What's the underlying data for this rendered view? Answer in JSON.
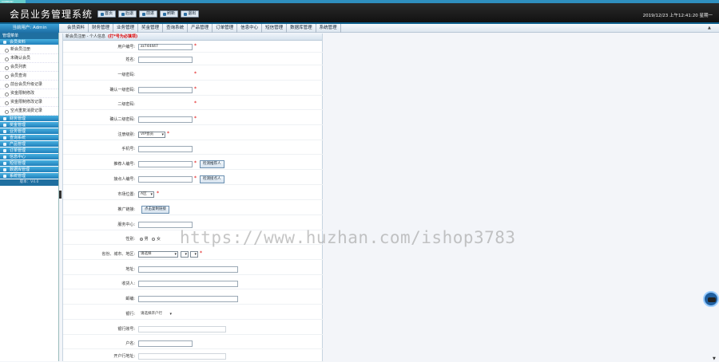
{
  "brand_strip": "COMPANY",
  "header": {
    "title": "会员业务管理系统",
    "buttons": [
      "首页",
      "后退",
      "前进",
      "刷新",
      "退出"
    ],
    "datetime": "2019/12/23 上午12:41:20 星期一"
  },
  "nav": {
    "user": "当前用户: Admin",
    "menu": [
      "会员资料",
      "财务管理",
      "业务管理",
      "奖金管理",
      "查询系统",
      "产品管理",
      "订单管理",
      "信息中心",
      "短信管理",
      "数据库管理",
      "系统管理"
    ]
  },
  "sidebar": {
    "top": "管理菜单",
    "active_section": "会员资料",
    "items": [
      "新会员注册",
      "未确认会员",
      "会员列表",
      "会员查询",
      "前台会员升级记录",
      "资金限制修改",
      "资金限制修改记录",
      "空点重复消费记录"
    ],
    "sections": [
      "财务管理",
      "奖金管理",
      "业务管理",
      "查询系统",
      "产品管理",
      "订单管理",
      "信息中心",
      "短信管理",
      "数据库管理",
      "系统管理"
    ],
    "footer": "版本：V4.0"
  },
  "form": {
    "title": "新会员注册 - 个人信息",
    "required_note": "(打*号为必填项)",
    "labels": {
      "user_id": "用户编号:",
      "name": "姓名:",
      "password1": "一级密码:",
      "password1_confirm": "确认一级密码:",
      "password2": "二级密码:",
      "password2_confirm": "确认二级密码:",
      "level": "注册级别:",
      "mobile": "手机号:",
      "referrer": "推荐人编号:",
      "placement": "接点人编号:",
      "position": "市场位置:",
      "promo_link": "推广链接:",
      "service_center": "服务中心:",
      "gender": "性别:",
      "region": "省份、城市、地区:",
      "address": "地址:",
      "receiver": "收货人:",
      "postcode": "邮编:",
      "bank": "银行:",
      "bank_account": "银行账号:",
      "account_name": "户名:",
      "bank_branch": "开户行地址:"
    },
    "values": {
      "user_id": "zz744447",
      "level": "VIP会员",
      "position": "A区",
      "gender_male": "男",
      "gender_female": "女",
      "province": "请选择",
      "bank": "请选择开户行"
    },
    "buttons": {
      "check_referrer": "检测推荐人",
      "check_placement": "检测接点人",
      "copy_link": "点击复制链接"
    }
  },
  "watermark": "https://www.huzhan.com/ishop3783"
}
